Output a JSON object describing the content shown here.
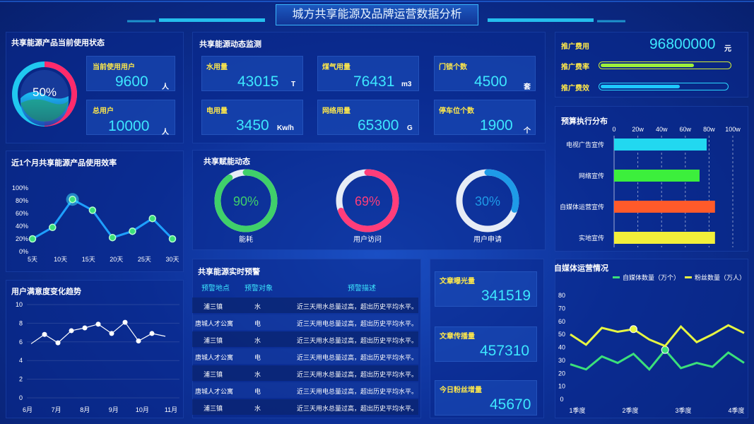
{
  "header": {
    "title": "城方共享能源及品牌运营数据分析"
  },
  "status": {
    "title": "共享能源产品当前使用状态",
    "ring_pct": "50%",
    "ring_value": 0.5,
    "current_users_label": "当前使用用户",
    "current_users": "9600",
    "current_users_unit": "人",
    "total_users_label": "总用户",
    "total_users": "10000",
    "total_users_unit": "人"
  },
  "monitor": {
    "title": "共享能源动态监测",
    "items": [
      {
        "label": "水用量",
        "value": "43015",
        "unit": "T"
      },
      {
        "label": "煤气用量",
        "value": "76431",
        "unit": "m3"
      },
      {
        "label": "门锁个数",
        "value": "4500",
        "unit": "套"
      },
      {
        "label": "电用量",
        "value": "3450",
        "unit": "Kw/h"
      },
      {
        "label": "网络用量",
        "value": "65300",
        "unit": "G"
      },
      {
        "label": "停车位个数",
        "value": "1900",
        "unit": "个"
      }
    ]
  },
  "promo": {
    "cost_label": "推广费用",
    "cost_value": "96800000",
    "cost_unit": "元",
    "rate_label": "推广费率",
    "rate_value": 0.72,
    "effect_label": "推广费效",
    "effect_value": 0.62
  },
  "empower": {
    "title": "共享赋能动态",
    "rings": [
      {
        "label": "能耗",
        "pct": "90%",
        "value": 0.9,
        "color": "#3fd06a"
      },
      {
        "label": "用户访问",
        "pct": "69%",
        "value": 0.69,
        "color": "#ff3d7a"
      },
      {
        "label": "用户申请",
        "pct": "30%",
        "value": 0.3,
        "color": "#1e9be8"
      }
    ]
  },
  "warning": {
    "title": "共享能源实时预警",
    "headers": [
      "预警地点",
      "预警对象",
      "预警描述"
    ],
    "rows": [
      [
        "浦三镇",
        "水",
        "近三天用水总量过高，超出历史平均水平。"
      ],
      [
        "唐城人才公寓",
        "电",
        "近三天用电总量过高，超出历史平均水平。"
      ],
      [
        "浦三镇",
        "水",
        "近三天用水总量过高，超出历史平均水平。"
      ],
      [
        "唐城人才公寓",
        "电",
        "近三天用电总量过高，超出历史平均水平。"
      ],
      [
        "浦三镇",
        "水",
        "近三天用水总量过高，超出历史平均水平。"
      ],
      [
        "唐城人才公寓",
        "电",
        "近三天用电总量过高，超出历史平均水平。"
      ],
      [
        "浦三镇",
        "水",
        "近三天用水总量过高，超出历史平均水平。"
      ]
    ]
  },
  "articles": {
    "items": [
      {
        "label": "文章曝光量",
        "value": "341519"
      },
      {
        "label": "文章传播量",
        "value": "457310"
      },
      {
        "label": "今日粉丝增量",
        "value": "45670"
      }
    ]
  },
  "chart_data": [
    {
      "type": "line",
      "title": "近1个月共享能源产品使用效率",
      "categories": [
        "5天",
        "10天",
        "15天",
        "20天",
        "25天",
        "30天"
      ],
      "x": [
        5,
        8,
        11,
        14,
        17,
        20,
        23,
        26,
        29
      ],
      "values": [
        20,
        38,
        82,
        65,
        22,
        32,
        52,
        20
      ],
      "ylim": [
        0,
        100
      ],
      "yticks": [
        "0%",
        "20%",
        "40%",
        "60%",
        "80%",
        "100%"
      ]
    },
    {
      "type": "line",
      "title": "用户满意度变化趋势",
      "categories": [
        "6月",
        "7月",
        "8月",
        "9月",
        "10月",
        "11月"
      ],
      "values": [
        5.8,
        6.8,
        5.9,
        7.2,
        7.5,
        7.9,
        6.9,
        8.1,
        6.1,
        6.9,
        6.6
      ],
      "ylim": [
        0,
        10
      ],
      "yticks": [
        "0",
        "2",
        "4",
        "6",
        "8",
        "10"
      ]
    },
    {
      "type": "bar",
      "title": "预算执行分布",
      "categories": [
        "电视广告宣传",
        "网络宣传",
        "自媒体运营宣传",
        "实地宣传"
      ],
      "values": [
        78,
        72,
        85,
        85
      ],
      "colors": [
        "#22d8f0",
        "#3cef3c",
        "#ff5a2a",
        "#f2ef3a"
      ],
      "xlim": [
        0,
        100
      ],
      "xticks": [
        "0",
        "20w",
        "40w",
        "60w",
        "80w",
        "100w"
      ]
    },
    {
      "type": "line",
      "title": "自媒体运营情况",
      "categories": [
        "1季度",
        "2季度",
        "3季度",
        "4季度"
      ],
      "series": [
        {
          "name": "自媒体数量（万个）",
          "color": "#3be07a",
          "values": [
            27,
            23,
            33,
            28,
            35,
            23,
            38,
            24,
            28,
            25,
            36,
            28
          ]
        },
        {
          "name": "粉丝数量（万人）",
          "color": "#e6f542",
          "values": [
            50,
            42,
            55,
            52,
            54,
            46,
            41,
            56,
            44,
            50,
            57,
            51
          ]
        }
      ],
      "ylim": [
        0,
        80
      ],
      "yticks": [
        "0",
        "10",
        "20",
        "30",
        "40",
        "50",
        "60",
        "70",
        "80"
      ]
    }
  ]
}
